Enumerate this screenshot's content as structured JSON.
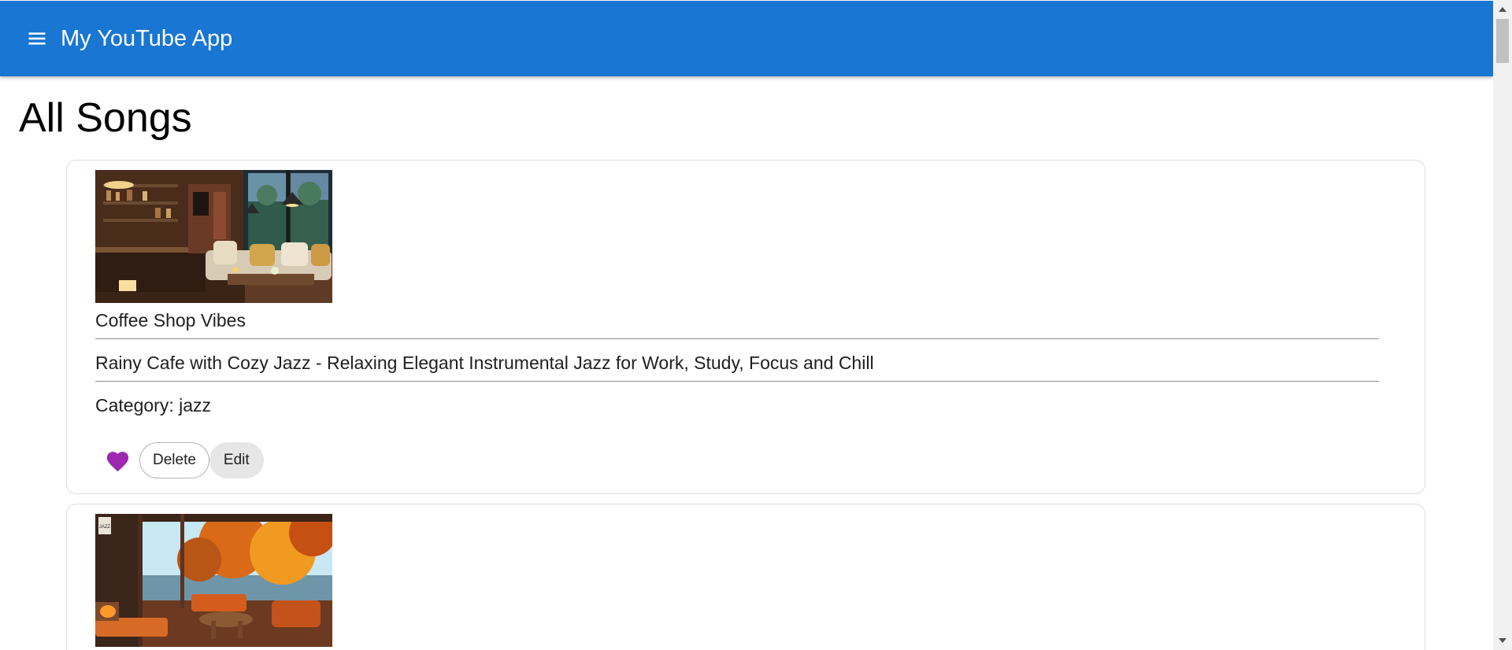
{
  "app": {
    "title": "My YouTube App",
    "menu_icon": "menu-icon",
    "header_color": "#1976d2"
  },
  "page": {
    "title": "All Songs"
  },
  "songs": [
    {
      "title": "Coffee Shop Vibes",
      "description": "Rainy Cafe with Cozy Jazz - Relaxing Elegant Instrumental Jazz for Work, Study, Focus and Chill",
      "category": "Category: jazz",
      "favorite_icon": "heart-icon",
      "favorite_color": "#9c27b0",
      "delete_label": "Delete",
      "edit_label": "Edit"
    },
    {
      "thumbnail_badge": "JAZZ"
    }
  ]
}
